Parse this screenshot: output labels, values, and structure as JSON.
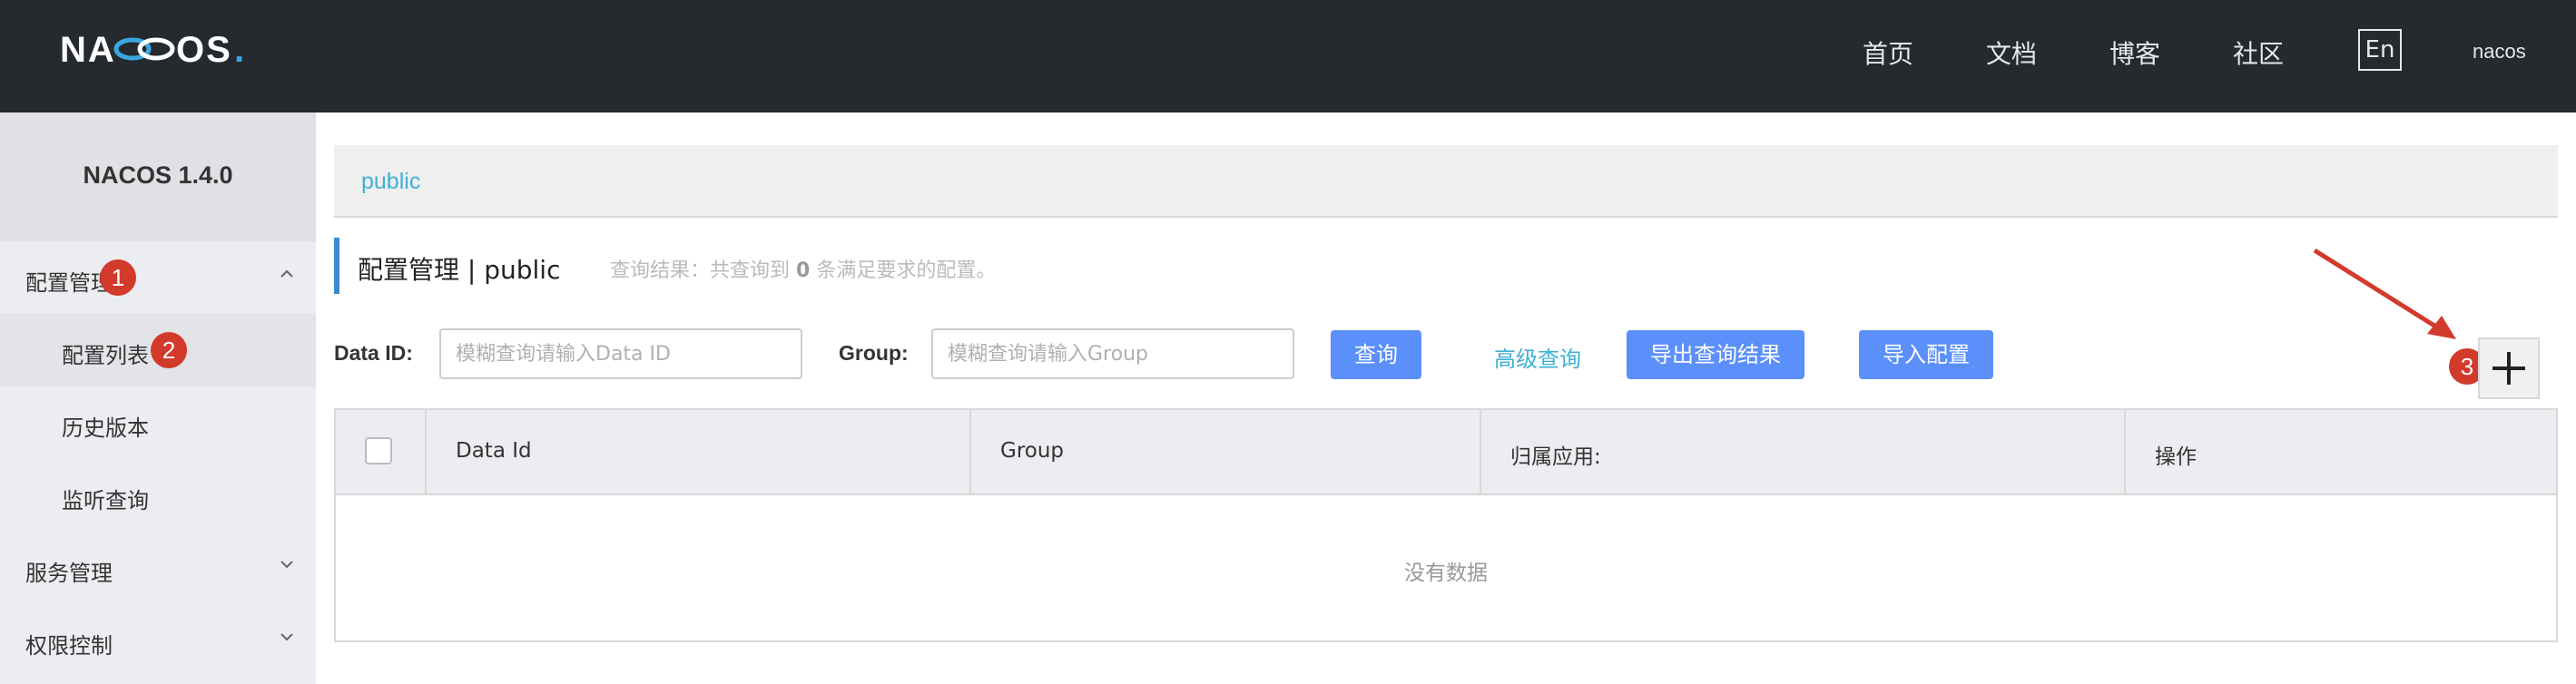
{
  "header": {
    "logo_text": "NACOS.",
    "nav": [
      "首页",
      "文档",
      "博客",
      "社区"
    ],
    "lang_button": "En",
    "user": "nacos"
  },
  "sidebar": {
    "title": "NACOS 1.4.0",
    "items": [
      {
        "label": "配置管理",
        "expanded": true
      },
      {
        "label": "配置列表",
        "sub": true,
        "active": true
      },
      {
        "label": "历史版本",
        "sub": true
      },
      {
        "label": "监听查询",
        "sub": true
      },
      {
        "label": "服务管理",
        "expanded": false
      },
      {
        "label": "权限控制",
        "expanded": false
      }
    ]
  },
  "namespace": {
    "current": "public"
  },
  "page": {
    "title": "配置管理 | public",
    "summary_prefix": "查询结果：共查询到",
    "count": "0",
    "summary_suffix": "条满足要求的配置。"
  },
  "filters": {
    "data_id_label": "Data ID:",
    "data_id_placeholder": "模糊查询请输入Data ID",
    "group_label": "Group:",
    "group_placeholder": "模糊查询请输入Group",
    "query_button": "查询",
    "advanced_query": "高级查询",
    "export_button": "导出查询结果",
    "import_button": "导入配置"
  },
  "table": {
    "columns": [
      "Data Id",
      "Group",
      "归属应用:",
      "操作"
    ],
    "empty_text": "没有数据"
  },
  "annotations": {
    "badge1": "1",
    "badge2": "2",
    "badge3": "3"
  },
  "colors": {
    "header_bg": "#252a2f",
    "primary": "#5b8ff9",
    "link": "#3eb0d6",
    "annotation": "#d23a2c"
  }
}
